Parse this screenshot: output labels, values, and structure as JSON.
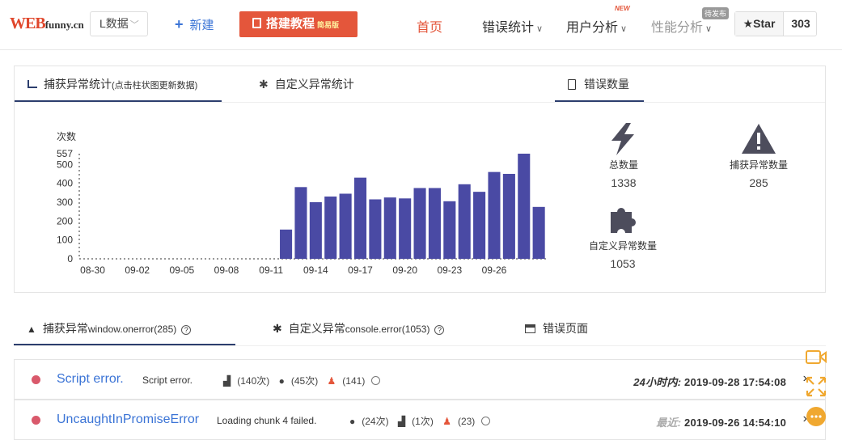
{
  "header": {
    "logo_main": "WEB",
    "logo_sub": "funny.cn",
    "project_select": "L数据",
    "new_label": "新建",
    "tutorial_label": "搭建教程",
    "tutorial_badge": "简易版",
    "nav": {
      "home": "首页",
      "errors": "错误统计",
      "users": "用户分析",
      "users_tag": "NEW",
      "perf": "性能分析",
      "perf_tag": "待发布"
    },
    "star_label": "Star",
    "star_count": "303"
  },
  "panel": {
    "tab_caught": "捕获异常统计",
    "tab_caught_hint": "(点击柱状图更新数据)",
    "tab_custom": "自定义异常统计",
    "tab_count": "错误数量"
  },
  "chart_data": {
    "type": "bar",
    "ylabel": "次数",
    "ymax_label": "557",
    "yticks": [
      "0",
      "100",
      "200",
      "300",
      "400",
      "500"
    ],
    "ylim": [
      0,
      557
    ],
    "x_tick_labels": [
      "08-30",
      "09-02",
      "09-05",
      "09-08",
      "09-11",
      "09-14",
      "09-17",
      "09-20",
      "09-23",
      "09-26"
    ],
    "bar_color": "#4a4aa4",
    "values": [
      0,
      0,
      0,
      0,
      0,
      0,
      0,
      0,
      0,
      0,
      0,
      0,
      0,
      155,
      380,
      300,
      330,
      345,
      430,
      315,
      325,
      320,
      375,
      375,
      305,
      395,
      355,
      460,
      450,
      557,
      275
    ]
  },
  "stats": {
    "total_label": "总数量",
    "total_value": "1338",
    "caught_label": "捕获异常数量",
    "caught_value": "285",
    "custom_label": "自定义异常数量",
    "custom_value": "1053"
  },
  "bottom_tabs": {
    "caught_cn": "捕获异常",
    "caught_en": "window.onerror",
    "caught_count": "(285)",
    "custom_cn": "自定义异常",
    "custom_en": "console.error",
    "custom_count": "(1053)",
    "pages": "错误页面"
  },
  "rows": [
    {
      "name": "Script error.",
      "message": "Script error.",
      "s1": "(140次)",
      "s2": "(45次)",
      "s3": "(141)",
      "time_label": "24小时内:",
      "time": "2019-09-28 17:54:08"
    },
    {
      "name": "UncaughtInPromiseError",
      "message": "Loading chunk 4 failed.",
      "s1": "(24次)",
      "s2": "(1次)",
      "s3": "(23)",
      "time_label": "最近:",
      "time": "2019-09-26 14:54:10"
    }
  ],
  "colors": {
    "accent_red": "#e4563b",
    "link_blue": "#3b74d6",
    "bar": "#4a4aa4",
    "dot": "#d9596b",
    "side_orange": "#f0a830"
  }
}
